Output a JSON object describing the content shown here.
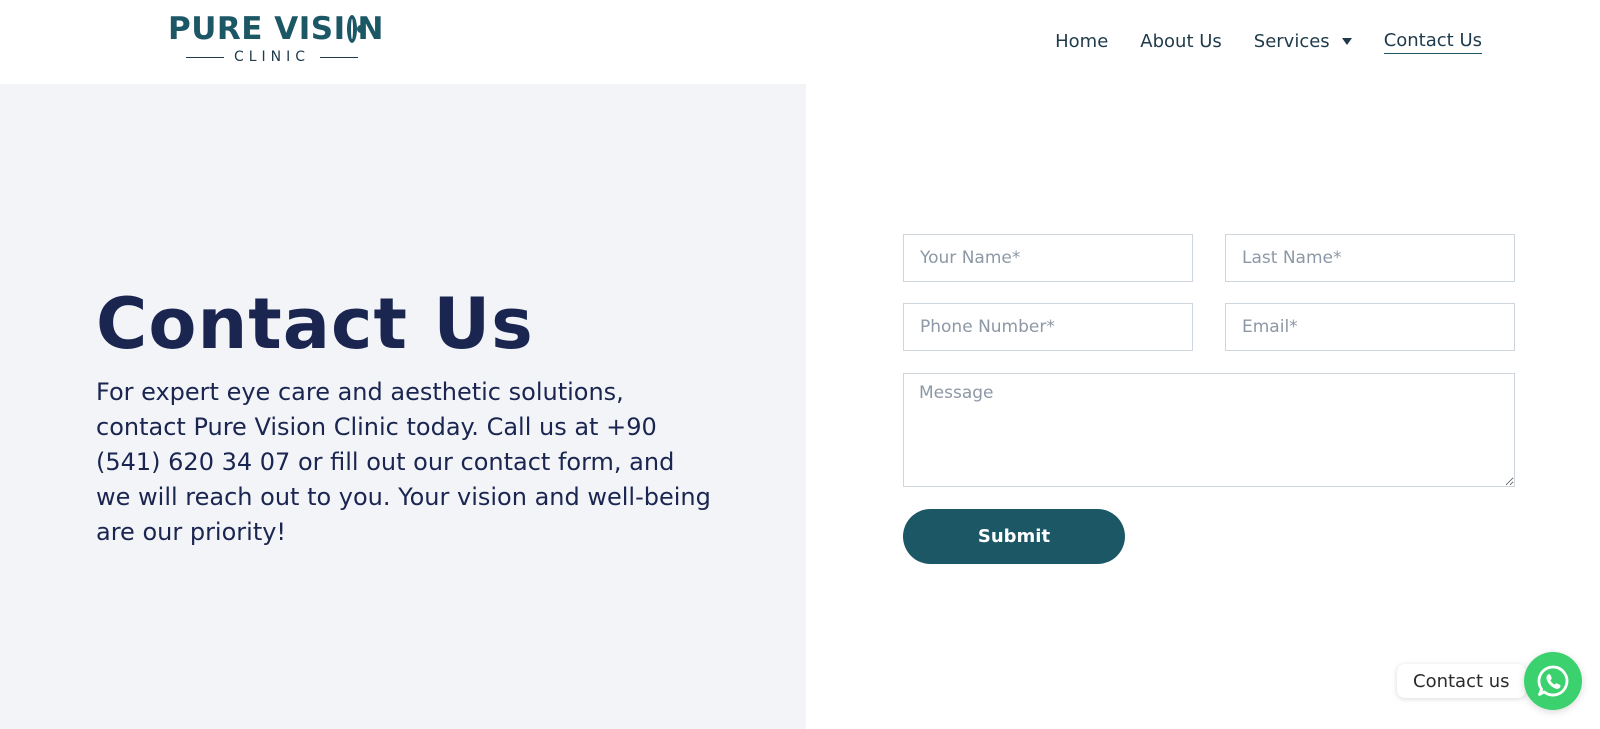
{
  "header": {
    "logo": {
      "text_before": "PURE VISI",
      "text_after": "N",
      "subtitle": "CLINIC"
    },
    "nav": [
      {
        "label": "Home"
      },
      {
        "label": "About Us"
      },
      {
        "label": "Services",
        "has_dropdown": true
      },
      {
        "label": "Contact Us",
        "active": true
      }
    ]
  },
  "hero": {
    "title": "Contact Us",
    "description": "For expert eye care and aesthetic solutions, contact Pure Vision Clinic today. Call us at +90 (541) 620 34 07 or fill out our contact form, and we will reach out to you. Your vision and well-being are our priority!"
  },
  "form": {
    "first_name": {
      "placeholder": "Your Name*",
      "value": ""
    },
    "last_name": {
      "placeholder": "Last Name*",
      "value": ""
    },
    "phone": {
      "placeholder": "Phone Number*",
      "value": ""
    },
    "email": {
      "placeholder": "Email*",
      "value": ""
    },
    "message": {
      "placeholder": "Message",
      "value": ""
    },
    "submit_label": "Submit"
  },
  "whatsapp": {
    "label": "Contact us",
    "icon": "whatsapp-icon"
  },
  "colors": {
    "brand": "#1c5766",
    "heading": "#1a2550",
    "panel_bg": "#f2f4f8",
    "whatsapp_green": "#3bd16f"
  }
}
